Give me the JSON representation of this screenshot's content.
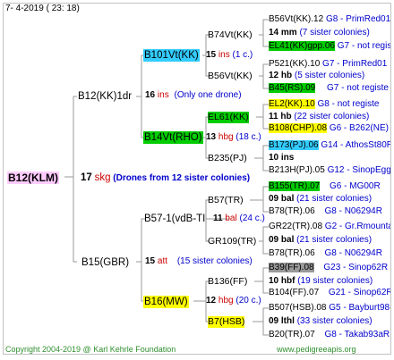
{
  "header": {
    "date": "7-  4-2019 ( 23: 18)"
  },
  "footer": {
    "copyright": "Copyright 2004-2019 @ Karl Kehrle Foundation",
    "url": "www.pedigreeapis.org"
  },
  "colors": {
    "cyan": "#33ccff",
    "green": "#00cc00",
    "yellow": "#ffff00",
    "pink": "#ffccff",
    "gray": "#999999",
    "blue_text": "#0000cc",
    "red_text": "#cc0000"
  },
  "root": {
    "name": "B12(KLM)",
    "num": "17",
    "code": "skg",
    "note": "(Drones from 12 sister colonies)"
  },
  "gen1": [
    {
      "name": "B12(KK)1dr",
      "num": "16",
      "code": "ins",
      "note": "(Only one drone)"
    },
    {
      "name": "B15(GBR)",
      "num": "15",
      "code": "att",
      "note": "(15 sister colonies)"
    }
  ],
  "gen2": [
    {
      "name": "B101Vt(KK)",
      "num": "15",
      "code": "ins",
      "note": "(1 c.)"
    },
    {
      "name": "B14Vt(RHO)",
      "num": "13",
      "code": "hbg",
      "note": "(18 c.)"
    },
    {
      "name": "B57-1(vdB-TI",
      "num": "11",
      "code": "bal",
      "note": "(24 c.)"
    },
    {
      "name": "B16(MW)",
      "num": "12",
      "code": "hbg",
      "note": "(20 c.)"
    }
  ],
  "gen3": [
    {
      "name": "B74Vt(KK)"
    },
    {
      "name": "B56Vt(KK)"
    },
    {
      "name": "EL61(KK)"
    },
    {
      "name": "B235(PJ)"
    },
    {
      "name": "B57(TR)"
    },
    {
      "name": "GR109(TR)"
    },
    {
      "name": "B136(FF)"
    },
    {
      "name": "B7(HSB)"
    }
  ],
  "gen4": [
    {
      "name": "B56Vt(KK).12",
      "ref": "G8 - PrimRed01"
    },
    {
      "name": "14 mm",
      "note": "(7 sister colonies)"
    },
    {
      "name": "EL41(KK)gpp.06",
      "ref": "G7 - not registe"
    },
    {
      "name": "P521(KK).10",
      "ref": "G7 - PrimRed01"
    },
    {
      "name": "12 hb",
      "note": "(5 sister colonies)"
    },
    {
      "name": "B45(RS).09",
      "ref": "G7 - not registe"
    },
    {
      "name": "EL2(KK).10",
      "ref": "G8 - not registe"
    },
    {
      "name": "11 hb",
      "note": "(22 sister colonies)"
    },
    {
      "name": "B108(CHP).08",
      "ref": "G6 - B262(NE)"
    },
    {
      "name": "B173(PJ).06",
      "ref": "G14 - AthosSt80R"
    },
    {
      "name": "10 ins",
      "note": ""
    },
    {
      "name": "B213H(PJ).05",
      "ref": "G12 - SinopEgg86R"
    },
    {
      "name": "B155(TR).07",
      "ref": "G6 - MG00R"
    },
    {
      "name": "09 bal",
      "note": "(21 sister colonies)"
    },
    {
      "name": "B78(TR).06",
      "ref": "G8 - N06294R"
    },
    {
      "name": "GR22(TR).08",
      "ref": "G2 - Gr.Rmounta"
    },
    {
      "name": "09 bal",
      "note": "(21 sister colonies)"
    },
    {
      "name": "B78(TR).06",
      "ref": "G8 - N06294R"
    },
    {
      "name": "B39(FF).08",
      "ref": "G23 - Sinop62R"
    },
    {
      "name": "10 hbf",
      "note": "(19 sister colonies)"
    },
    {
      "name": "B104(FF).07",
      "ref": "G21 - Sinop62R"
    },
    {
      "name": "B507(HSB).08",
      "ref": "G5 - Bayburt98-3"
    },
    {
      "name": "09 lthl",
      "note": "(33 sister colonies)"
    },
    {
      "name": "B20(TR).07",
      "ref": "G8 - Takab93aR"
    }
  ]
}
